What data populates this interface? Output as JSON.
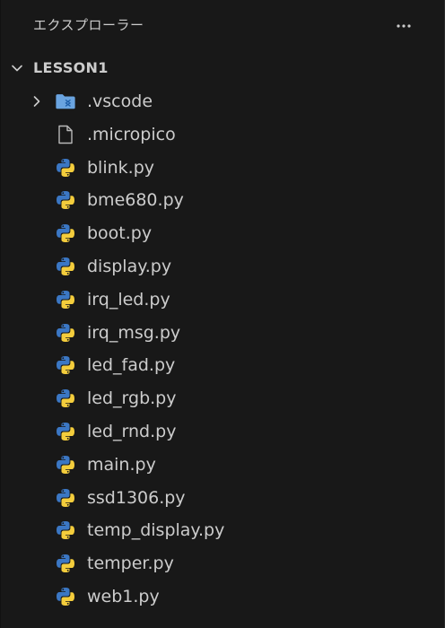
{
  "explorer": {
    "title": "エクスプローラー",
    "more_icon": "more-horizontal-icon",
    "folder": {
      "name": "LESSON1",
      "expanded": true,
      "chevron_icon": "chevron-down-icon"
    },
    "items": [
      {
        "label": ".vscode",
        "kind": "folder",
        "icon": "vscode-folder-icon",
        "chevron_icon": "chevron-right-icon"
      },
      {
        "label": ".micropico",
        "kind": "file",
        "icon": "file-icon"
      },
      {
        "label": "blink.py",
        "kind": "python",
        "icon": "python-icon"
      },
      {
        "label": "bme680.py",
        "kind": "python",
        "icon": "python-icon"
      },
      {
        "label": "boot.py",
        "kind": "python",
        "icon": "python-icon"
      },
      {
        "label": "display.py",
        "kind": "python",
        "icon": "python-icon"
      },
      {
        "label": "irq_led.py",
        "kind": "python",
        "icon": "python-icon"
      },
      {
        "label": "irq_msg.py",
        "kind": "python",
        "icon": "python-icon"
      },
      {
        "label": "led_fad.py",
        "kind": "python",
        "icon": "python-icon"
      },
      {
        "label": "led_rgb.py",
        "kind": "python",
        "icon": "python-icon"
      },
      {
        "label": "led_rnd.py",
        "kind": "python",
        "icon": "python-icon"
      },
      {
        "label": "main.py",
        "kind": "python",
        "icon": "python-icon"
      },
      {
        "label": "ssd1306.py",
        "kind": "python",
        "icon": "python-icon"
      },
      {
        "label": "temp_display.py",
        "kind": "python",
        "icon": "python-icon"
      },
      {
        "label": "temper.py",
        "kind": "python",
        "icon": "python-icon"
      },
      {
        "label": "web1.py",
        "kind": "python",
        "icon": "python-icon"
      }
    ]
  },
  "colors": {
    "background": "#181818",
    "text": "#cccccc",
    "folder_blue": "#6aa4e0",
    "python_blue": "#3b77c4",
    "python_yellow": "#f4cd3c"
  }
}
